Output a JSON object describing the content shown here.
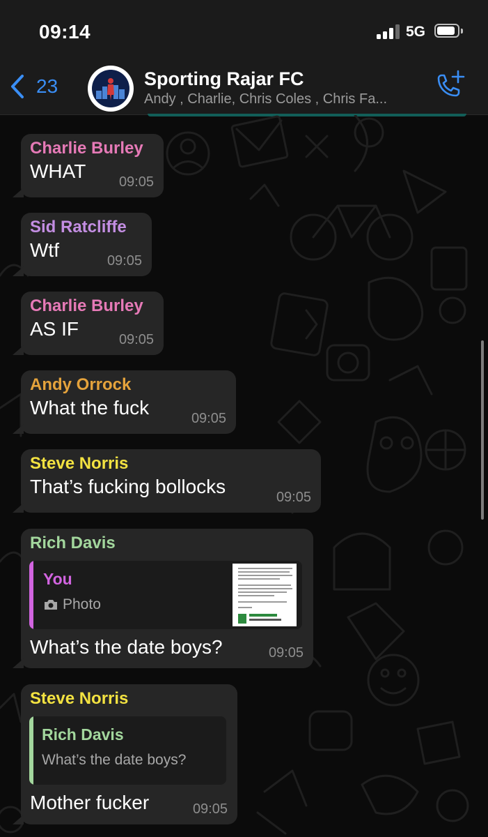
{
  "status": {
    "time": "09:14",
    "network": "5G",
    "battery_level": 0.9
  },
  "header": {
    "back_count": "23",
    "title": "Sporting Rajar FC",
    "subtitle": "Andy , Charlie, Chris  Coles , Chris  Fa..."
  },
  "messages": [
    {
      "sender": "Charlie Burley",
      "sender_color": "#e67ab7",
      "text": "WHAT",
      "time": "09:05"
    },
    {
      "sender": "Sid  Ratcliffe",
      "sender_color": "#c38ee2",
      "text": "Wtf",
      "time": "09:05"
    },
    {
      "sender": "Charlie Burley",
      "sender_color": "#e67ab7",
      "text": "AS IF",
      "time": "09:05"
    },
    {
      "sender": "Andy  Orrock",
      "sender_color": "#e5a33c",
      "text": "What the fuck",
      "time": "09:05"
    },
    {
      "sender": "Steve  Norris",
      "sender_color": "#f3e241",
      "text": "That’s fucking bollocks",
      "time": "09:05"
    },
    {
      "sender": "Rich  Davis",
      "sender_color": "#a3d79d",
      "reply": {
        "author": "You",
        "author_color": "#d264e0",
        "text": "Photo",
        "icon": "camera-icon"
      },
      "text": "What’s the date boys?",
      "time": "09:05"
    },
    {
      "sender": "Steve  Norris",
      "sender_color": "#f3e241",
      "reply": {
        "author": "Rich  Davis",
        "author_color": "#a3d79d",
        "text": "What’s the date boys?"
      },
      "text": "Mother fucker",
      "time": "09:05"
    }
  ],
  "colors": {
    "bubble": "#262626",
    "link_blue": "#3a8ef5",
    "background": "#0b0b0b"
  }
}
